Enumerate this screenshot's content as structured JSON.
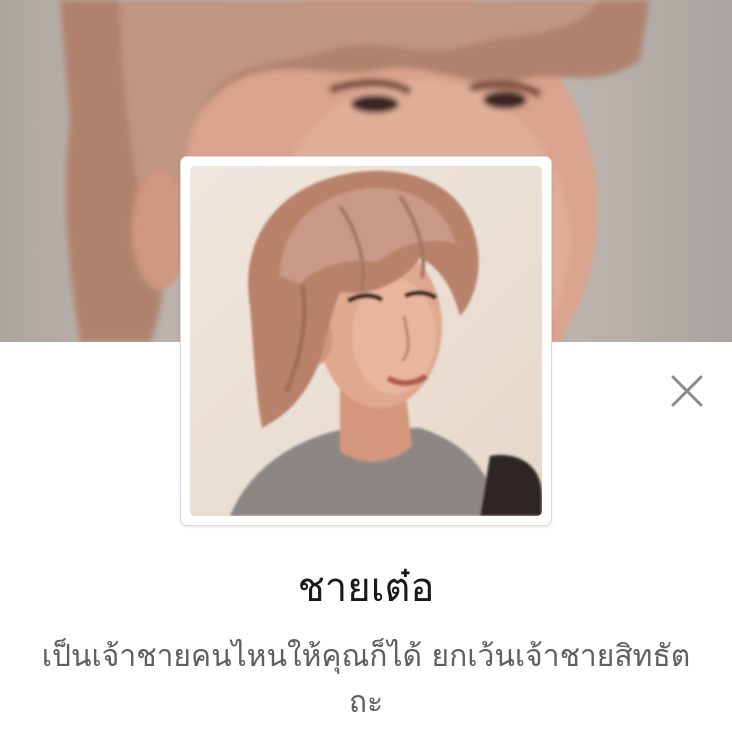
{
  "profile": {
    "name": "ชายเต๋อ",
    "status_message": "เป็นเจ้าชายคนไหนให้คุณก็ได้ ยกเว้นเจ้าชายสิทธัตถะ",
    "cover_photo": "cover-photo",
    "profile_photo": "profile-photo"
  },
  "controls": {
    "close_icon": "close-icon"
  },
  "colors": {
    "name_text": "#1a1a1a",
    "status_text": "#5f5f5f",
    "close_icon": "#8c8c8c",
    "card_border": "#d9d9d9",
    "background": "#ffffff"
  }
}
